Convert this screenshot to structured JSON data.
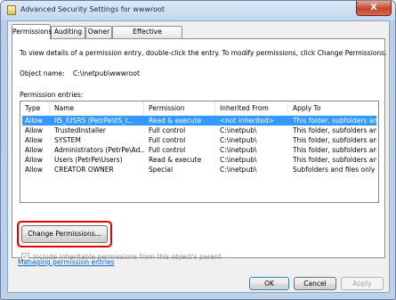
{
  "window": {
    "title": "Advanced Security Settings for wwwroot",
    "close_glyph": "X"
  },
  "tabs": [
    {
      "label": "Permissions",
      "active": true
    },
    {
      "label": "Auditing",
      "active": false
    },
    {
      "label": "Owner",
      "active": false
    },
    {
      "label": "Effective Permissions",
      "active": false
    }
  ],
  "panel": {
    "description": "To view details of a permission entry, double-click the entry. To modify permissions, click Change Permissions.",
    "object_name_label": "Object name:",
    "object_name_value": "C:\\inetpub\\wwwroot",
    "entries_label": "Permission entries:"
  },
  "grid": {
    "columns": [
      "Type",
      "Name",
      "Permission",
      "Inherited From",
      "Apply To"
    ],
    "rows": [
      {
        "type": "Allow",
        "name": "IIS_IUSRS (PetrPe\\IIS_I...",
        "permission": "Read & execute",
        "inherited": "<not inherited>",
        "apply_to": "This folder, subfolders and...",
        "selected": true
      },
      {
        "type": "Allow",
        "name": "TrustedInstaller",
        "permission": "Full control",
        "inherited": "C:\\inetpub\\",
        "apply_to": "This folder, subfolders and...",
        "selected": false
      },
      {
        "type": "Allow",
        "name": "SYSTEM",
        "permission": "Full control",
        "inherited": "C:\\inetpub\\",
        "apply_to": "This folder, subfolders and...",
        "selected": false
      },
      {
        "type": "Allow",
        "name": "Administrators (PetrPe\\Ad...",
        "permission": "Full control",
        "inherited": "C:\\inetpub\\",
        "apply_to": "This folder, subfolders and...",
        "selected": false
      },
      {
        "type": "Allow",
        "name": "Users (PetrPe\\Users)",
        "permission": "Read & execute",
        "inherited": "C:\\inetpub\\",
        "apply_to": "This folder, subfolders and...",
        "selected": false
      },
      {
        "type": "Allow",
        "name": "CREATOR OWNER",
        "permission": "Special",
        "inherited": "C:\\inetpub\\",
        "apply_to": "Subfolders and files only",
        "selected": false
      }
    ]
  },
  "change_permissions_button": "Change Permissions...",
  "inherit_checkbox": {
    "label": "Include inheritable permissions from this object's parent",
    "checked": true,
    "enabled": false
  },
  "help_link": "Managing permission entries",
  "footer": {
    "ok": "OK",
    "cancel": "Cancel",
    "apply": "Apply"
  },
  "colors": {
    "selection": "#3399ff",
    "highlight_box": "#e00000",
    "link": "#0066cc"
  }
}
